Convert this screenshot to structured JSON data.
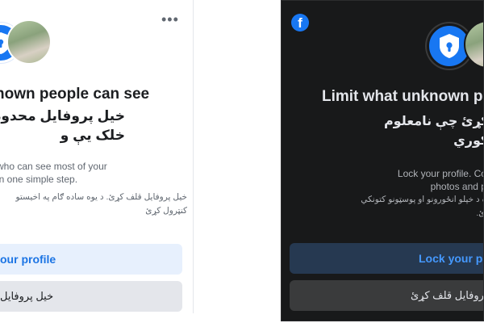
{
  "light_panel": {
    "more_icon": "more-horizontal-icon",
    "title": "nown people can see",
    "pashto_title": "خیل پروفایل محدود\nخلک یې و",
    "subtitle_line1": "who can see most of your",
    "subtitle_line2": "in one simple step.",
    "pashto_subtitle": "خیل پروفایل قلف کړئ. د یوه ساده ګام په اخیستو\nکنټرول کړئ",
    "lock_button_label": "our profile",
    "pashto_lock_button_label": "خیل پروفایل",
    "colors": {
      "background": "#ffffff",
      "accent": "#1877f2",
      "button_primary_bg": "#e7f0fd",
      "button_secondary_bg": "#e4e6eb"
    }
  },
  "dark_panel": {
    "logo": "facebook-logo-icon",
    "title": "Limit what unknown p",
    "pashto_title": "محدود کړئ چې نامعلوم\nې و نه ګوري",
    "subtitle_line1": "Lock your profile. Control who c",
    "subtitle_line2": "photos and posts in one",
    "pashto_subtitle": "یستلو سره د خپلو انځورونو او پوسټونو کتونکي\nکنټرول کړئ.",
    "lock_button_label": "Lock your p",
    "pashto_lock_button_label": "خپل پروفایل قلف کړئ",
    "colors": {
      "background": "#18191a",
      "accent": "#1877f2",
      "button_primary_bg": "#263951",
      "button_secondary_bg": "#3a3b3c"
    }
  }
}
